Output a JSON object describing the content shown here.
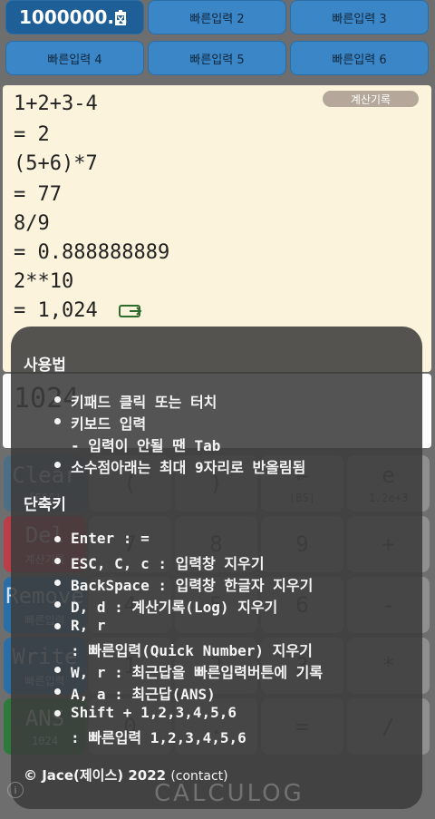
{
  "quick_buttons": [
    "1000000...",
    "빠른입력 2",
    "빠른입력 3",
    "빠른입력 4",
    "빠른입력 5",
    "빠른입력 6"
  ],
  "log": {
    "button_label": "계산기록",
    "lines": [
      "1+2+3-4",
      "= 2",
      "(5+6)*7",
      "= 77",
      "8/9",
      "= 0.888888889",
      "2**10",
      "= 1,024"
    ]
  },
  "input": {
    "value": "1024"
  },
  "keys": [
    {
      "main": "Clear",
      "sub": "[ESC]"
    },
    {
      "main": "(",
      "sub": ""
    },
    {
      "main": ")",
      "sub": ""
    },
    {
      "main": "←",
      "sub": "[BS]"
    },
    {
      "main": "e",
      "sub": "1.2e+3"
    },
    {
      "main": "Del",
      "sub": "계산기록"
    },
    {
      "main": "7",
      "sub": ""
    },
    {
      "main": "8",
      "sub": ""
    },
    {
      "main": "9",
      "sub": ""
    },
    {
      "main": "+",
      "sub": ""
    },
    {
      "main": "Remove",
      "sub": "빠른입력"
    },
    {
      "main": "4",
      "sub": ""
    },
    {
      "main": "5",
      "sub": ""
    },
    {
      "main": "6",
      "sub": ""
    },
    {
      "main": "-",
      "sub": ""
    },
    {
      "main": "Write",
      "sub": "빠른입력"
    },
    {
      "main": "1",
      "sub": ""
    },
    {
      "main": "2",
      "sub": ""
    },
    {
      "main": "3",
      "sub": ""
    },
    {
      "main": "*",
      "sub": ""
    },
    {
      "main": "ANS",
      "sub": "1024"
    },
    {
      "main": "0",
      "sub": ""
    },
    {
      "main": ".",
      "sub": ""
    },
    {
      "main": "=",
      "sub": ""
    },
    {
      "main": "/",
      "sub": ""
    }
  ],
  "overlay": {
    "usage_title": "사용법",
    "usage_items": [
      "키패드 클릭 또는 터치",
      "키보드 입력",
      "- 입력이 안될 땐 Tab",
      "소수점아래는 최대 9자리로 반올림됨"
    ],
    "shortcut_title": "단축키",
    "shortcut_items": [
      "Enter : =",
      "ESC, C, c : 입력창 지우기",
      "BackSpace : 입력창 한글자 지우기",
      "D, d : 계산기록(Log) 지우기",
      "R, r",
      ": 빠른입력(Quick Number) 지우기",
      "W, r : 최근답을 빠른입력버튼에 기록",
      "A, a : 최근답(ANS)",
      "Shift + 1,2,3,4,5,6",
      ": 빠른입력 1,2,3,4,5,6"
    ],
    "footer_credit": "© Jace(제이스) 2022",
    "footer_contact": "(contact)",
    "brand": "CALCULOG"
  },
  "colors": {
    "accent": "#3b86c6",
    "log_bg": "#fcf3dc",
    "overlay": "#3c3c3c"
  }
}
